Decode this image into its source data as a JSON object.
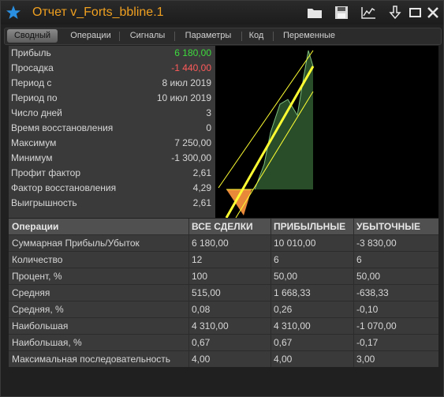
{
  "window": {
    "title": "Отчет v_Forts_bbline.1",
    "colors": {
      "title": "#f0a020",
      "positive": "#3ddc3d",
      "negative": "#ff5a5a",
      "chart_fill": "#2f5a2f",
      "chart_line": "#ffff33"
    },
    "toolbar_icons": [
      "folder-icon",
      "save-icon",
      "chart-icon",
      "download-icon",
      "maximize-icon",
      "close-icon"
    ]
  },
  "tabs": [
    {
      "label": "Сводный",
      "active": true
    },
    {
      "label": "Операции"
    },
    {
      "label": "Сигналы"
    },
    {
      "label": "Параметры"
    },
    {
      "label": "Код"
    },
    {
      "label": "Переменные"
    }
  ],
  "stats": [
    {
      "label": "Прибыль",
      "value": "6 180,00",
      "tone": "green"
    },
    {
      "label": "Просадка",
      "value": "-1 440,00",
      "tone": "red"
    },
    {
      "label": "Период с",
      "value": "8 июл 2019"
    },
    {
      "label": "Период по",
      "value": "10 июл 2019"
    },
    {
      "label": "Число дней",
      "value": "3"
    },
    {
      "label": "Время восстановления",
      "value": "0"
    },
    {
      "label": "Максимум",
      "value": "7 250,00"
    },
    {
      "label": "Минимум",
      "value": "-1 300,00"
    },
    {
      "label": "Профит фактор",
      "value": "2,61"
    },
    {
      "label": "Фактор восстановления",
      "value": "4,29"
    },
    {
      "label": "Выигрышность",
      "value": "2,61"
    }
  ],
  "table": {
    "headers": [
      "Операции",
      "ВСЕ СДЕЛКИ",
      "ПРИБЫЛЬНЫЕ",
      "УБЫТОЧНЫЕ"
    ],
    "rows": [
      [
        "Суммарная Прибыль/Убыток",
        "6 180,00",
        "10 010,00",
        "-3 830,00"
      ],
      [
        "Количество",
        "12",
        "6",
        "6"
      ],
      [
        "Процент, %",
        "100",
        "50,00",
        "50,00"
      ],
      [
        "Средняя",
        "515,00",
        "1 668,33",
        "-638,33"
      ],
      [
        "Средняя, %",
        "0,08",
        "0,26",
        "-0,10"
      ],
      [
        "Наибольшая",
        "4 310,00",
        "4 310,00",
        "-1 070,00"
      ],
      [
        "Наибольшая, %",
        "0,67",
        "0,67",
        "-0,17"
      ],
      [
        "Максимальная последовательность",
        "4,00",
        "4,00",
        "3,00"
      ]
    ]
  }
}
